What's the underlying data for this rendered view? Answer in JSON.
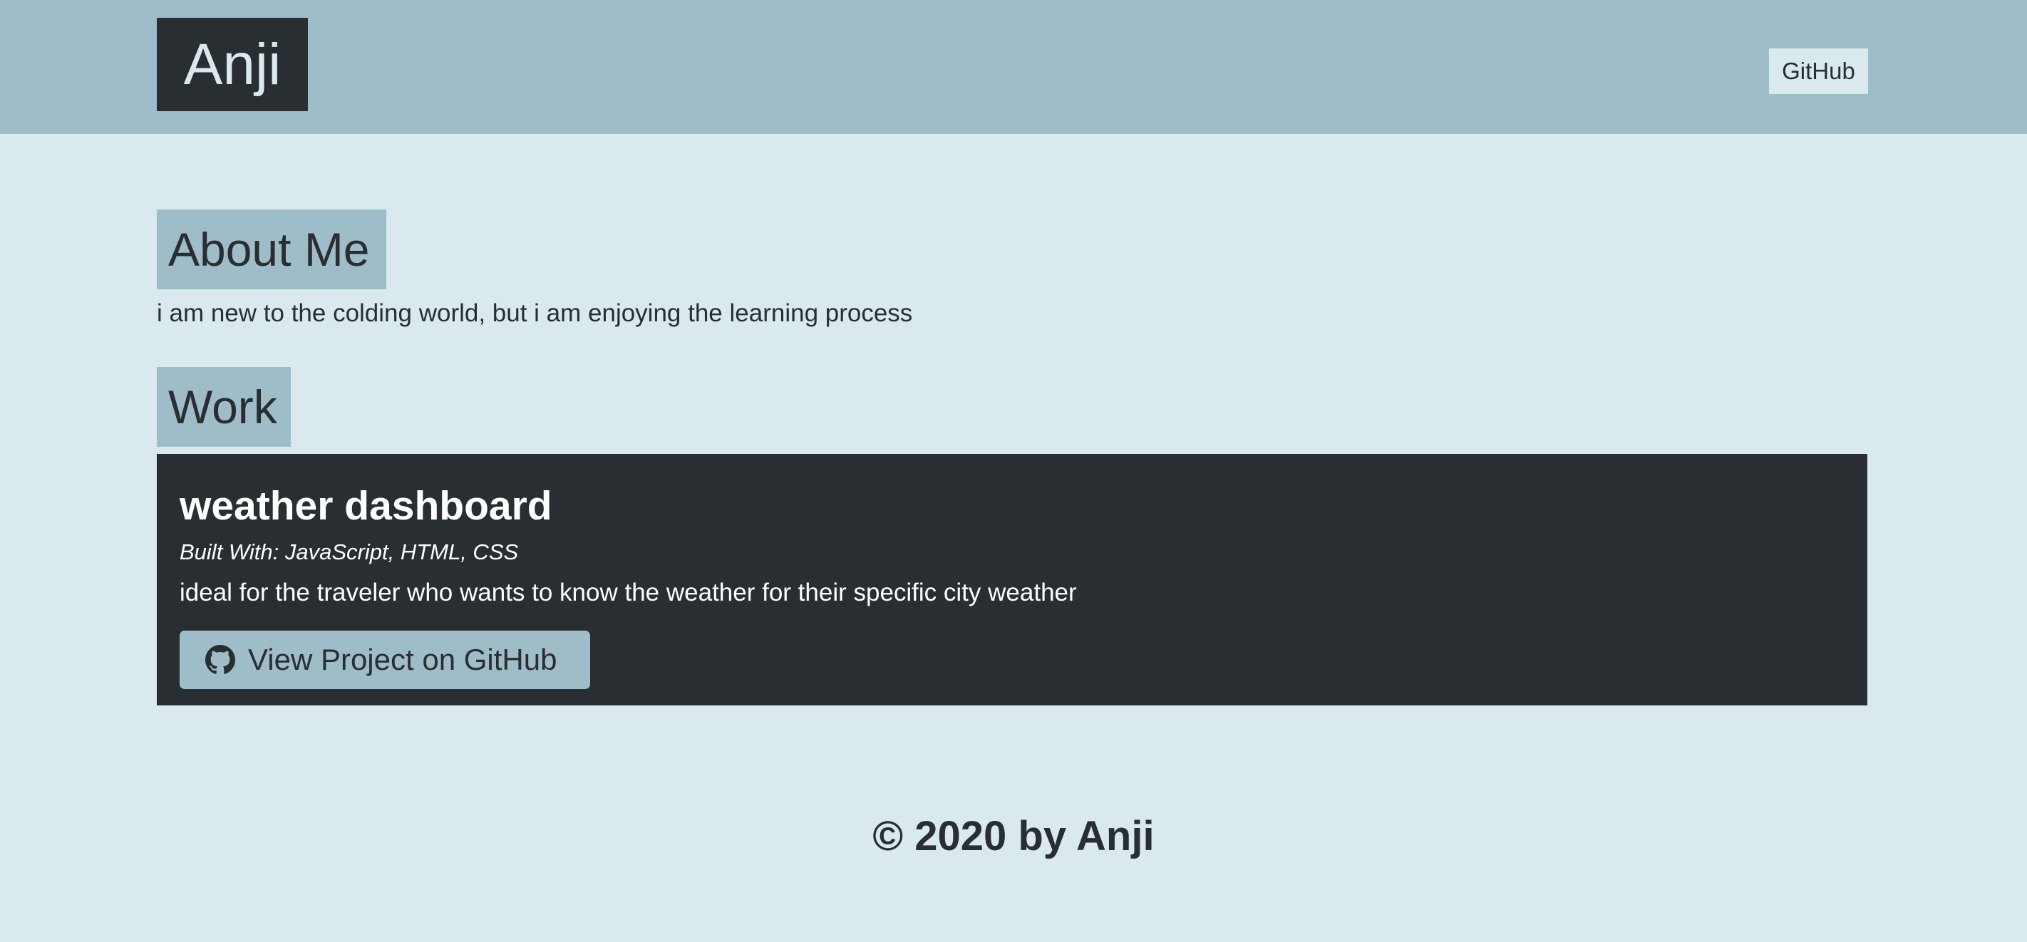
{
  "header": {
    "logo_text": "Anji",
    "nav": {
      "github_label": "GitHub"
    }
  },
  "about": {
    "heading": "About Me",
    "text": "i am new to the colding world, but i am enjoying the learning process"
  },
  "work": {
    "heading": "Work",
    "projects": [
      {
        "title": "weather dashboard",
        "built_with": "Built With: JavaScript, HTML, CSS",
        "description": "ideal for the traveler who wants to know the weather for their specific city weather",
        "button_label": "View Project on GitHub",
        "button_icon": "github-icon"
      }
    ]
  },
  "footer": {
    "text": "© 2020 by Anji"
  },
  "colors": {
    "page_background": "#dae9ee",
    "header_background": "#9fbdc8",
    "dark": "#282e32",
    "accent": "#9fbdc8"
  }
}
